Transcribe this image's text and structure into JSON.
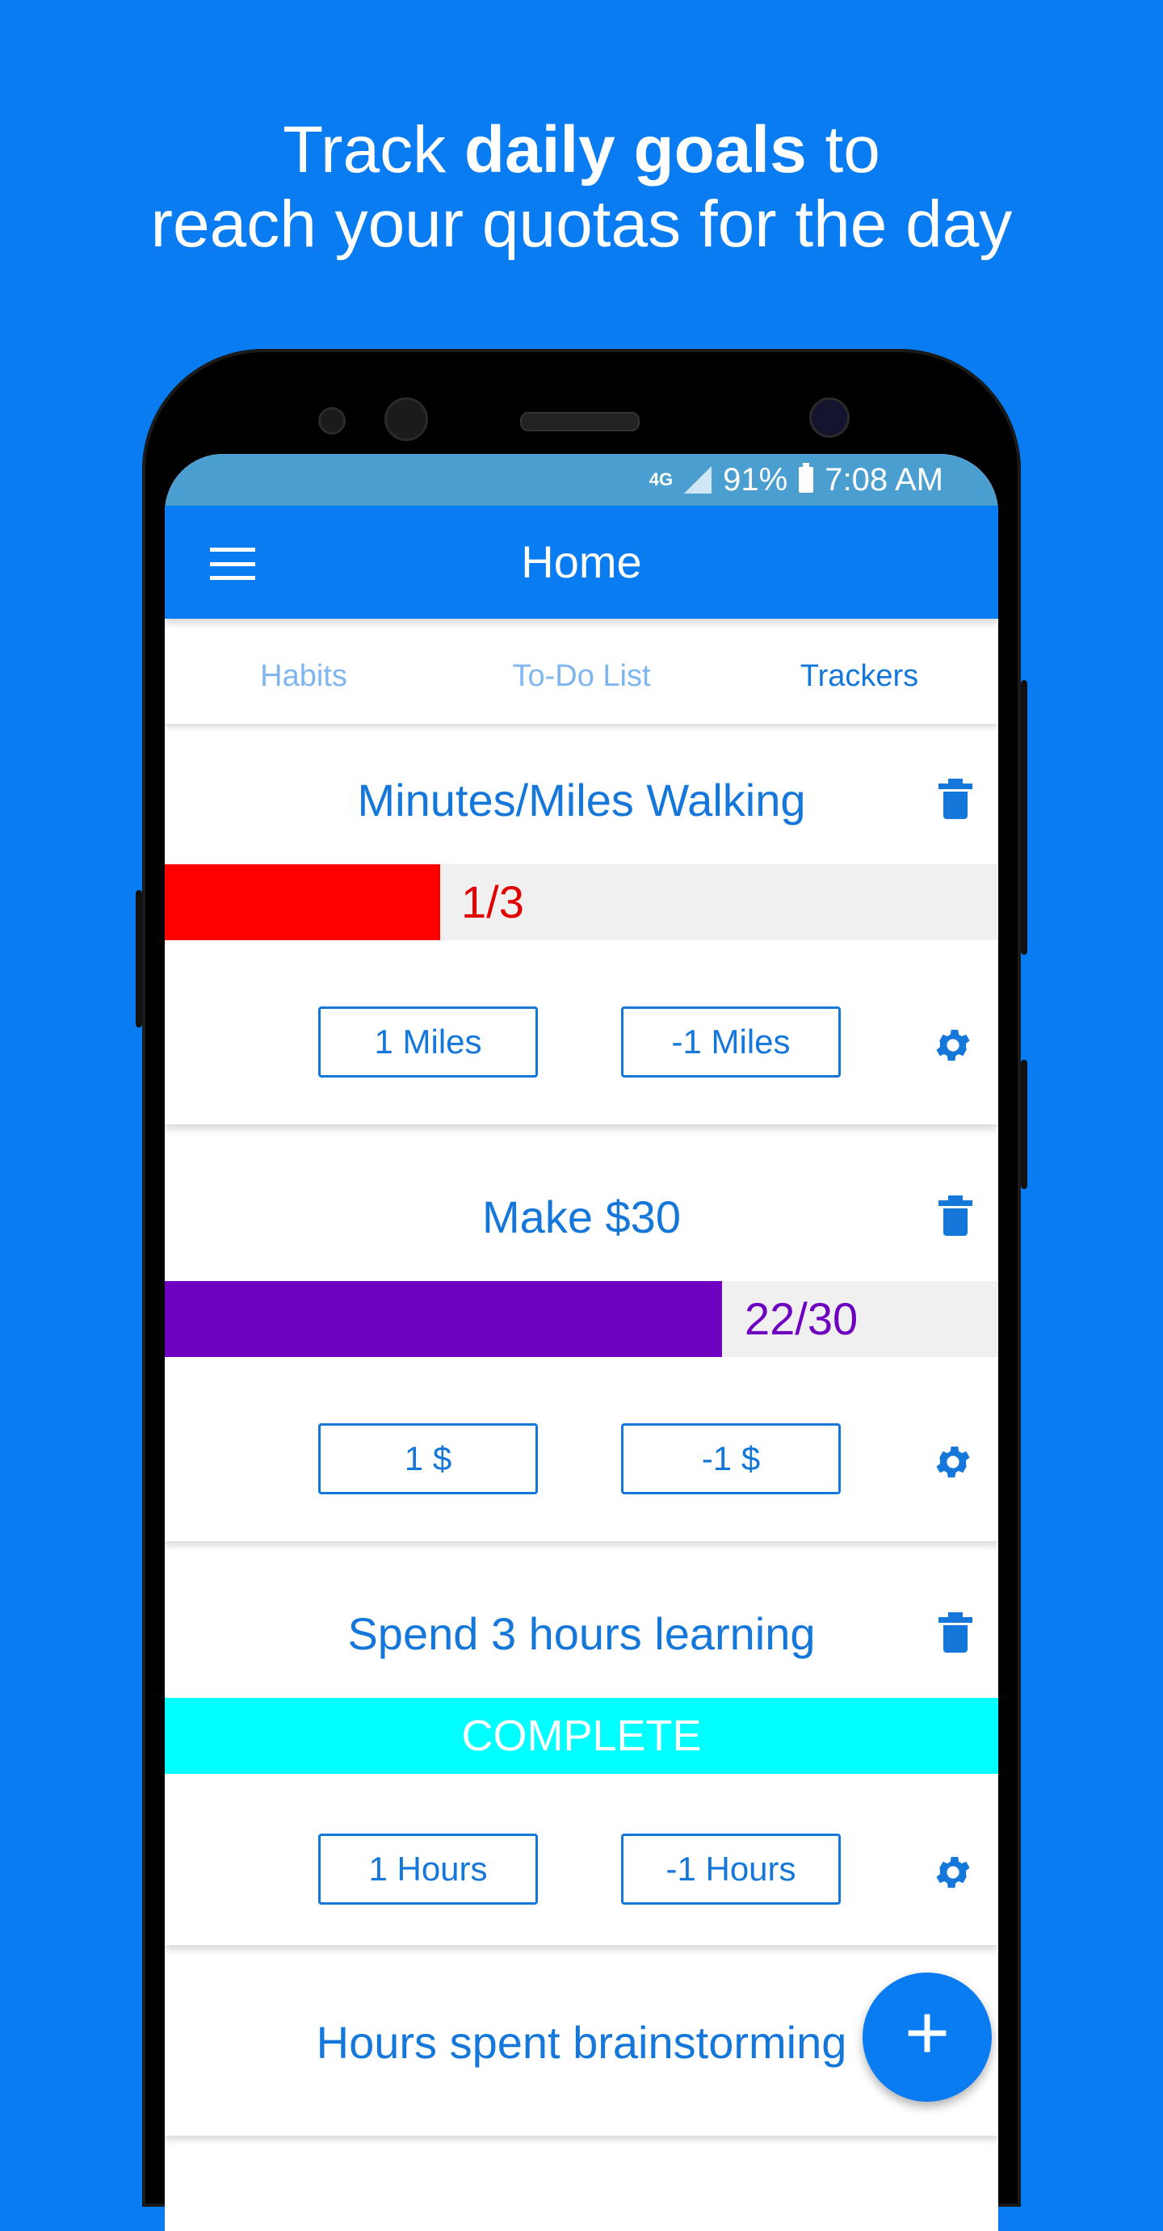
{
  "headline": {
    "pre": "Track ",
    "bold": "daily goals",
    "post": " to",
    "line2": "reach your quotas for the day"
  },
  "status_bar": {
    "network": "4G",
    "battery": "91%",
    "time": "7:08 AM"
  },
  "app_bar": {
    "title": "Home",
    "menu_icon": "hamburger-menu-icon"
  },
  "tabs": [
    {
      "label": "Habits",
      "active": false
    },
    {
      "label": "To-Do List",
      "active": false
    },
    {
      "label": "Trackers",
      "active": true
    }
  ],
  "trackers": [
    {
      "title": "Minutes/Miles Walking",
      "progress_label": "1/3",
      "progress_fraction": 0.333,
      "color": "#ff0000",
      "complete": false,
      "increment_label": "1 Miles",
      "decrement_label": "-1 Miles"
    },
    {
      "title": "Make $30",
      "progress_label": "22/30",
      "progress_fraction": 0.733,
      "color": "#6e00c0",
      "complete": false,
      "increment_label": "1 $",
      "decrement_label": "-1 $"
    },
    {
      "title": "Spend 3 hours learning",
      "progress_label": "COMPLETE",
      "progress_fraction": 1.0,
      "color": "#00ffff",
      "complete": true,
      "increment_label": "1 Hours",
      "decrement_label": "-1 Hours"
    },
    {
      "title": "Hours spent brainstorming"
    }
  ],
  "fab": {
    "label": "+"
  },
  "colors": {
    "background": "#0a7cf2",
    "primary": "#1477d9",
    "tab_inactive": "#7fb6ef",
    "status_bar": "#4a9fd0",
    "bar_track": "#f0f0f0"
  }
}
